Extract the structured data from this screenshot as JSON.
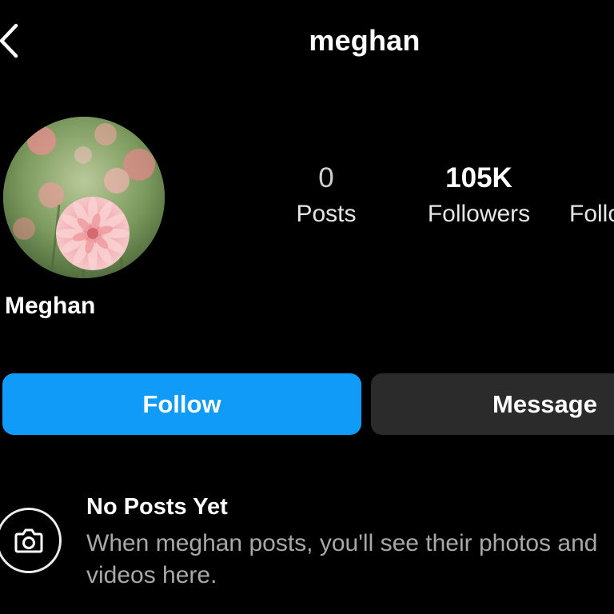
{
  "header": {
    "username": "meghan"
  },
  "profile": {
    "display_name": "Meghan",
    "stats": {
      "posts_count": "0",
      "posts_label": "Posts",
      "followers_count": "105K",
      "followers_label": "Followers",
      "following_label": "Following"
    }
  },
  "actions": {
    "follow_label": "Follow",
    "message_label": "Message"
  },
  "empty_state": {
    "title": "No Posts Yet",
    "description": "When meghan posts, you'll see their photos and videos here."
  },
  "icons": {
    "back": "chevron-left-icon",
    "camera": "camera-icon"
  },
  "colors": {
    "background": "#000000",
    "follow_button": "#0f9bf7",
    "message_button": "#2b2b2b",
    "secondary_text": "#a8a8a8"
  }
}
